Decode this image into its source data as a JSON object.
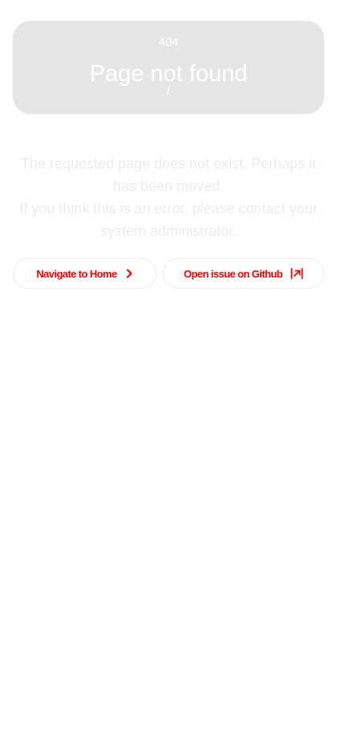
{
  "error": {
    "code": "404",
    "title": "Page not found",
    "path": "/"
  },
  "message": {
    "line1": "The requested page does not exist. Perhaps it has been moved.",
    "line2": "If you think this is an error, please contact your system administrator."
  },
  "actions": {
    "home_label": "Navigate to Home",
    "home_icon": "chevron-right-icon",
    "github_label": "Open issue on Github",
    "github_icon": "external-link-icon"
  },
  "colors": {
    "card_bg": "#e6e6e6",
    "button_text": "#ff0000",
    "message_text": "#ececec"
  }
}
